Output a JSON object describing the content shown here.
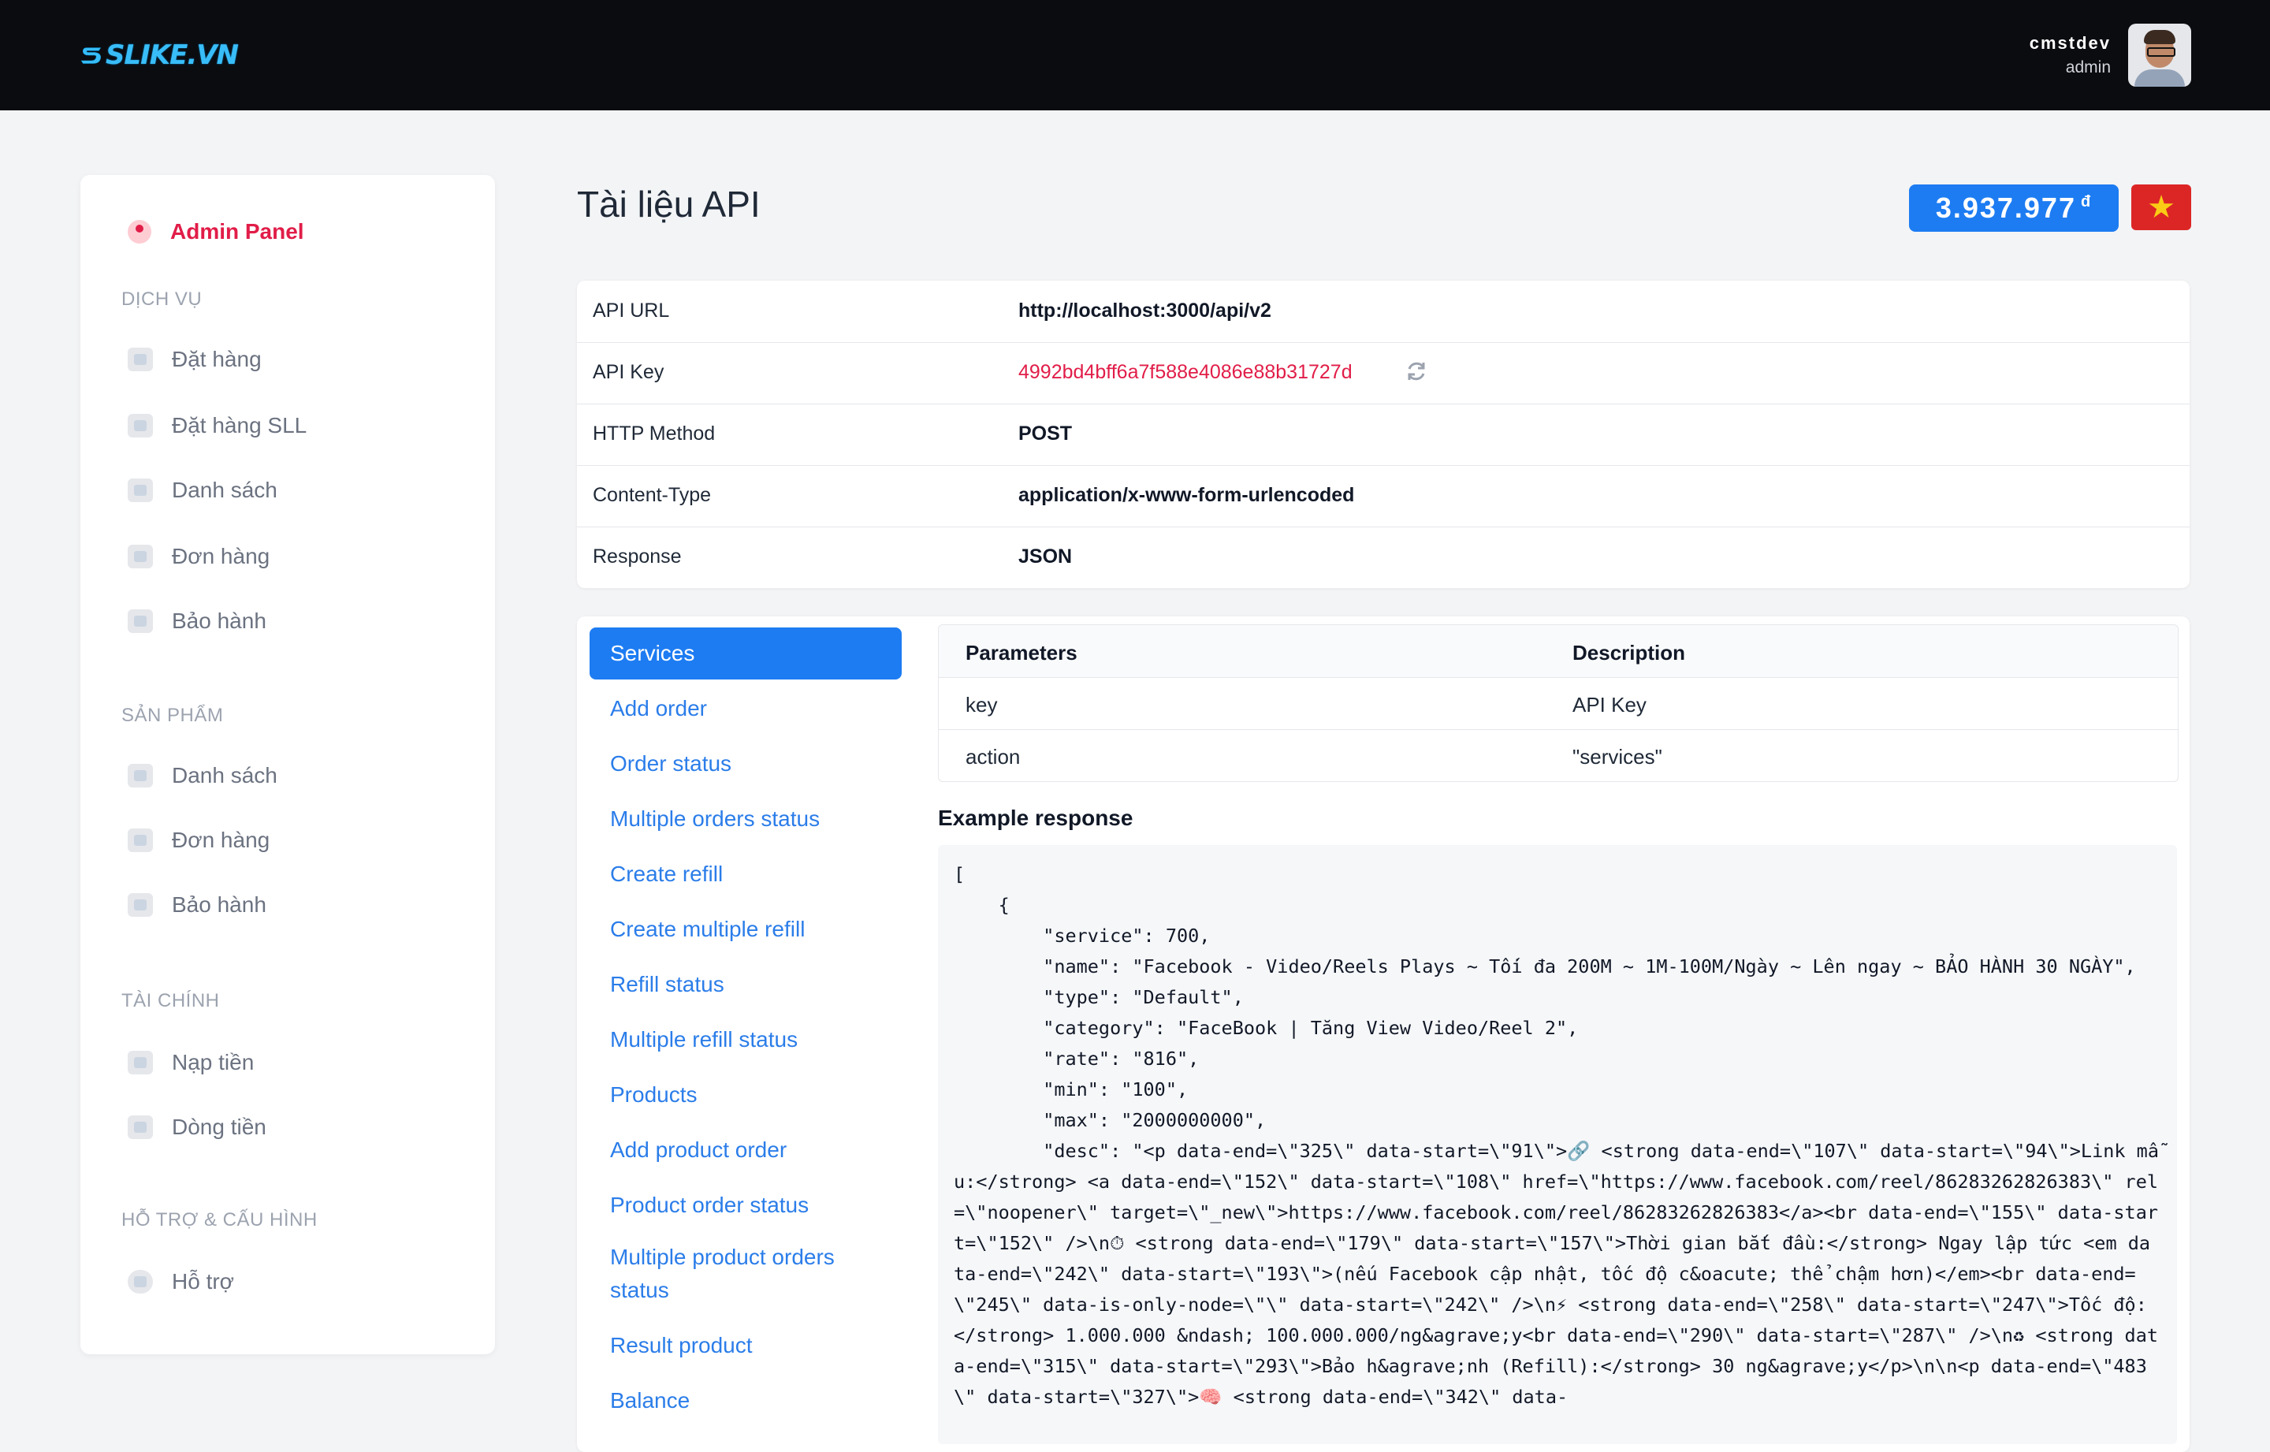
{
  "header": {
    "logo_text": "SLIKE.VN",
    "user_name": "cmstdev",
    "user_role": "admin"
  },
  "sidebar": {
    "admin_label": "Admin Panel",
    "sections": [
      {
        "title": "DỊCH VỤ",
        "items": [
          "Đặt hàng",
          "Đặt hàng SLL",
          "Danh sách",
          "Đơn hàng",
          "Bảo hành"
        ]
      },
      {
        "title": "SẢN PHẨM",
        "items": [
          "Danh sách",
          "Đơn hàng",
          "Bảo hành"
        ]
      },
      {
        "title": "TÀI CHÍNH",
        "items": [
          "Nạp tiền",
          "Dòng tiền"
        ]
      },
      {
        "title": "HỖ TRỢ & CẤU HÌNH",
        "items": [
          "Hỗ trợ"
        ]
      }
    ]
  },
  "page": {
    "title": "Tài liệu API",
    "balance": "3.937.977",
    "currency": "đ",
    "flag_symbol": "★"
  },
  "info": [
    {
      "key": "API URL",
      "value": "http://localhost:3000/api/v2"
    },
    {
      "key": "API Key",
      "value": "4992bd4bff6a7f588e4086e88b31727d"
    },
    {
      "key": "HTTP Method",
      "value": "POST"
    },
    {
      "key": "Content-Type",
      "value": "application/x-www-form-urlencoded"
    },
    {
      "key": "Response",
      "value": "JSON"
    }
  ],
  "nav": [
    "Services",
    "Add order",
    "Order status",
    "Multiple orders status",
    "Create refill",
    "Create multiple refill",
    "Refill status",
    "Multiple refill status",
    "Products",
    "Add product order",
    "Product order status",
    "Multiple product orders status",
    "Result product",
    "Balance"
  ],
  "params": {
    "headers": [
      "Parameters",
      "Description"
    ],
    "rows": [
      [
        "key",
        "API Key"
      ],
      [
        "action",
        "\"services\""
      ]
    ]
  },
  "example": {
    "title": "Example response",
    "code": "[\n    {\n        \"service\": 700,\n        \"name\": \"Facebook - Video/Reels Plays ~ Tối đa 200M ~ 1M-100M/Ngày ~ Lên ngay ~ BẢO HÀNH 30 NGÀY\",\n        \"type\": \"Default\",\n        \"category\": \"FaceBook | Tăng View Video/Reel 2\",\n        \"rate\": \"816\",\n        \"min\": \"100\",\n        \"max\": \"2000000000\",\n        \"desc\": \"<p data-end=\\\"325\\\" data-start=\\\"91\\\">🔗 <strong data-end=\\\"107\\\" data-start=\\\"94\\\">Link mẫu:</strong> <a data-end=\\\"152\\\" data-start=\\\"108\\\" href=\\\"https://www.facebook.com/reel/86283262826383\\\" rel=\\\"noopener\\\" target=\\\"_new\\\">https://www.facebook.com/reel/86283262826383</a><br data-end=\\\"155\\\" data-start=\\\"152\\\" />\\n⏱ <strong data-end=\\\"179\\\" data-start=\\\"157\\\">Thời gian bắt đầu:</strong> Ngay lập tức <em data-end=\\\"242\\\" data-start=\\\"193\\\">(nếu Facebook cập nhật, tốc độ c&oacute; thể chậm hơn)</em><br data-end=\\\"245\\\" data-is-only-node=\\\"\\\" data-start=\\\"242\\\" />\\n⚡ <strong data-end=\\\"258\\\" data-start=\\\"247\\\">Tốc độ:</strong> 1.000.000 &ndash; 100.000.000/ng&agrave;y<br data-end=\\\"290\\\" data-start=\\\"287\\\" />\\n♻ <strong data-end=\\\"315\\\" data-start=\\\"293\\\">Bảo h&agrave;nh (Refill):</strong> 30 ng&agrave;y</p>\\n\\n<p data-end=\\\"483\\\" data-start=\\\"327\\\">🧠 <strong data-end=\\\"342\\\" data-"
  },
  "colors": {
    "topbar": "#0b0c10",
    "accent": "#1d7cf2",
    "admin": "#e11d48",
    "api_key": "#e11d48",
    "flag": "#dc2626"
  }
}
